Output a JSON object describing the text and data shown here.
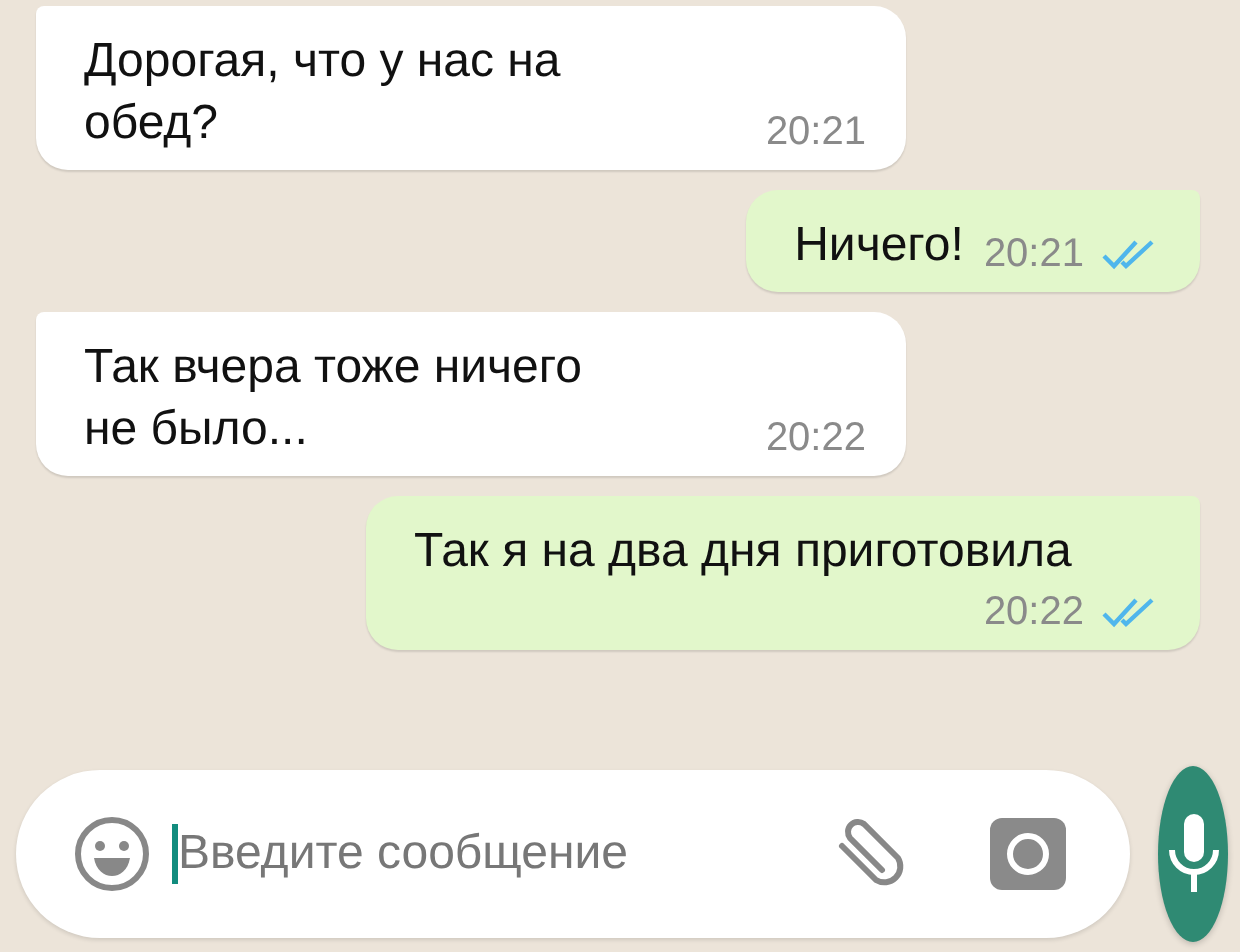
{
  "messages": [
    {
      "outgoing": false,
      "text": "Дорогая, что у нас на обед?",
      "time": "20:21"
    },
    {
      "outgoing": true,
      "text": "Ничего!",
      "time": "20:21",
      "read": true
    },
    {
      "outgoing": false,
      "text": "Так вчера тоже ничего не было...",
      "time": "20:22"
    },
    {
      "outgoing": true,
      "text": "Так я на два дня приготовила",
      "time": "20:22",
      "read": true
    }
  ],
  "composer": {
    "placeholder": "Введите сообщение"
  }
}
